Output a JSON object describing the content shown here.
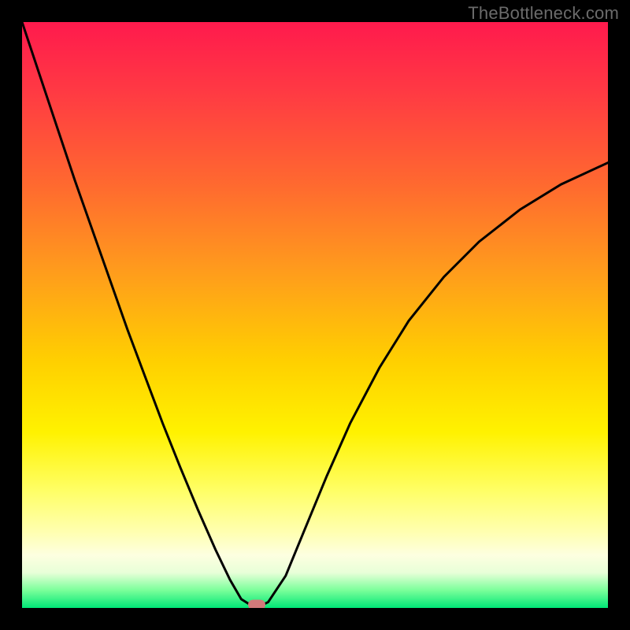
{
  "watermark": "TheBottleneck.com",
  "chart_data": {
    "type": "line",
    "title": "",
    "xlabel": "",
    "ylabel": "",
    "xlim": [
      0,
      1
    ],
    "ylim": [
      0,
      1
    ],
    "grid": false,
    "legend": false,
    "series": [
      {
        "name": "bottleneck-curve",
        "x": [
          0.0,
          0.03,
          0.06,
          0.09,
          0.12,
          0.15,
          0.18,
          0.21,
          0.24,
          0.27,
          0.3,
          0.33,
          0.355,
          0.374,
          0.39,
          0.41,
          0.42,
          0.45,
          0.48,
          0.52,
          0.56,
          0.61,
          0.66,
          0.72,
          0.78,
          0.85,
          0.92,
          1.0
        ],
        "y": [
          1.0,
          0.91,
          0.82,
          0.73,
          0.645,
          0.56,
          0.475,
          0.395,
          0.315,
          0.24,
          0.168,
          0.1,
          0.048,
          0.015,
          0.005,
          0.005,
          0.01,
          0.055,
          0.128,
          0.225,
          0.315,
          0.41,
          0.49,
          0.565,
          0.625,
          0.68,
          0.723,
          0.76
        ],
        "color": "#000000"
      }
    ],
    "marker": {
      "x": 0.4,
      "y": 0.005,
      "color": "#d17a7a"
    },
    "background_gradient": [
      "#ff1a4d",
      "#ff9a1d",
      "#fff200",
      "#00e676"
    ]
  }
}
